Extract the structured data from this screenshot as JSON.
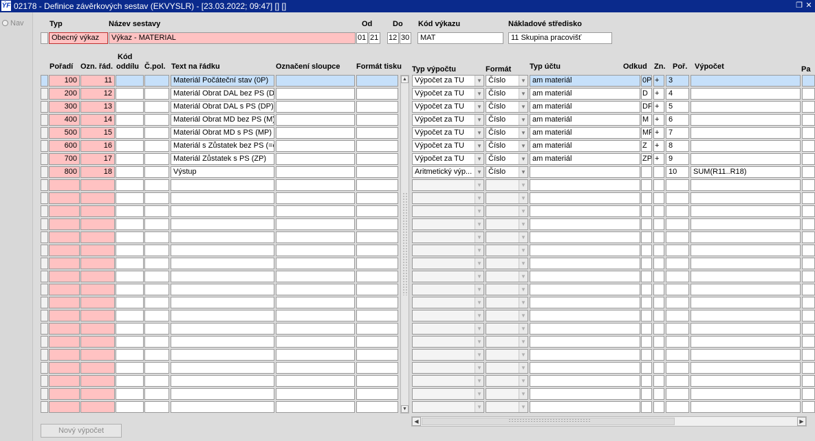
{
  "window": {
    "title": "02178 - Definice závěrkových sestav (EKVYSLR) - [23.03.2022; 09:47] [] []",
    "app_icon_text": "ÝF",
    "restore_icon": "restore-icon",
    "close_icon": "close-icon"
  },
  "nav": {
    "label": "Nav"
  },
  "header": {
    "typ_label": "Typ",
    "typ_value": "Obecný výkaz",
    "nazev_label": "Název sestavy",
    "nazev_value": "Výkaz - MATERIAL",
    "od_label": "Od",
    "od_day": "01",
    "od_month": "21",
    "do_label": "Do",
    "do_day": "12",
    "do_month": "30",
    "kod_label": "Kód výkazu",
    "kod_value": "MAT",
    "stredisko_label": "Nákladové středisko",
    "stredisko_value": "11 Skupina pracovišť"
  },
  "columns": {
    "poradi": "Pořadí",
    "ozn_rad": "Ozn. řád.",
    "kod_oddilu_1": "Kód",
    "kod_oddilu_2": "oddílu",
    "c_pol": "Č.pol.",
    "text": "Text na řádku",
    "oznaceni": "Označení sloupce",
    "format_tisku": "Formát tisku",
    "typ_vypoctu": "Typ výpočtu",
    "format": "Formát",
    "typ_uctu": "Typ účtu",
    "odkud": "Odkud",
    "zn": "Zn.",
    "por": "Poř.",
    "vypocet": "Výpočet",
    "extra": "Pa"
  },
  "rows": [
    {
      "poradi": "100",
      "ozn": "11",
      "text": "Materiál Počáteční stav (0P)",
      "typ_vypoctu": "Výpočet za TU",
      "format": "Číslo",
      "typ_uctu": "am materiál",
      "odkud": "0P",
      "zn": "+",
      "por": "3",
      "vypocet": ""
    },
    {
      "poradi": "200",
      "ozn": "12",
      "text": "Materiál Obrat DAL bez PS (D)",
      "typ_vypoctu": "Výpočet za TU",
      "format": "Číslo",
      "typ_uctu": "am materiál",
      "odkud": "D",
      "zn": "+",
      "por": "4",
      "vypocet": ""
    },
    {
      "poradi": "300",
      "ozn": "13",
      "text": "Materiál Obrat DAL s PS (DP)",
      "typ_vypoctu": "Výpočet za TU",
      "format": "Číslo",
      "typ_uctu": "am materiál",
      "odkud": "DP",
      "zn": "+",
      "por": "5",
      "vypocet": ""
    },
    {
      "poradi": "400",
      "ozn": "14",
      "text": "Materiál Obrat MD bez PS (M)",
      "typ_vypoctu": "Výpočet za TU",
      "format": "Číslo",
      "typ_uctu": "am materiál",
      "odkud": "M",
      "zn": "+",
      "por": "6",
      "vypocet": ""
    },
    {
      "poradi": "500",
      "ozn": "15",
      "text": "Materiál Obrat MD s PS (MP)",
      "typ_vypoctu": "Výpočet za TU",
      "format": "Číslo",
      "typ_uctu": "am materiál",
      "odkud": "MP",
      "zn": "+",
      "por": "7",
      "vypocet": ""
    },
    {
      "poradi": "600",
      "ozn": "16",
      "text": "Materiál s Zůstatek bez PS (=o",
      "typ_vypoctu": "Výpočet za TU",
      "format": "Číslo",
      "typ_uctu": "am materiál",
      "odkud": "Z",
      "zn": "+",
      "por": "8",
      "vypocet": ""
    },
    {
      "poradi": "700",
      "ozn": "17",
      "text": "Materiál Zůstatek s PS (ZP)",
      "typ_vypoctu": "Výpočet za TU",
      "format": "Číslo",
      "typ_uctu": "am materiál",
      "odkud": "ZP",
      "zn": "+",
      "por": "9",
      "vypocet": ""
    },
    {
      "poradi": "800",
      "ozn": "18",
      "text": "Výstup",
      "typ_vypoctu": "Aritmetický výp...",
      "format": "Číslo",
      "typ_uctu": "",
      "odkud": "",
      "zn": "",
      "por": "10",
      "vypocet": "SUM(R11..R18)"
    }
  ],
  "empty_row_count": 18,
  "buttons": {
    "novy_vypocet": "Nový výpočet"
  },
  "colors": {
    "titlebar": "#0a2a8c",
    "required_pink": "#ffc2c2",
    "selected_blue": "#c6e0fa",
    "background": "#dcdcdc"
  }
}
